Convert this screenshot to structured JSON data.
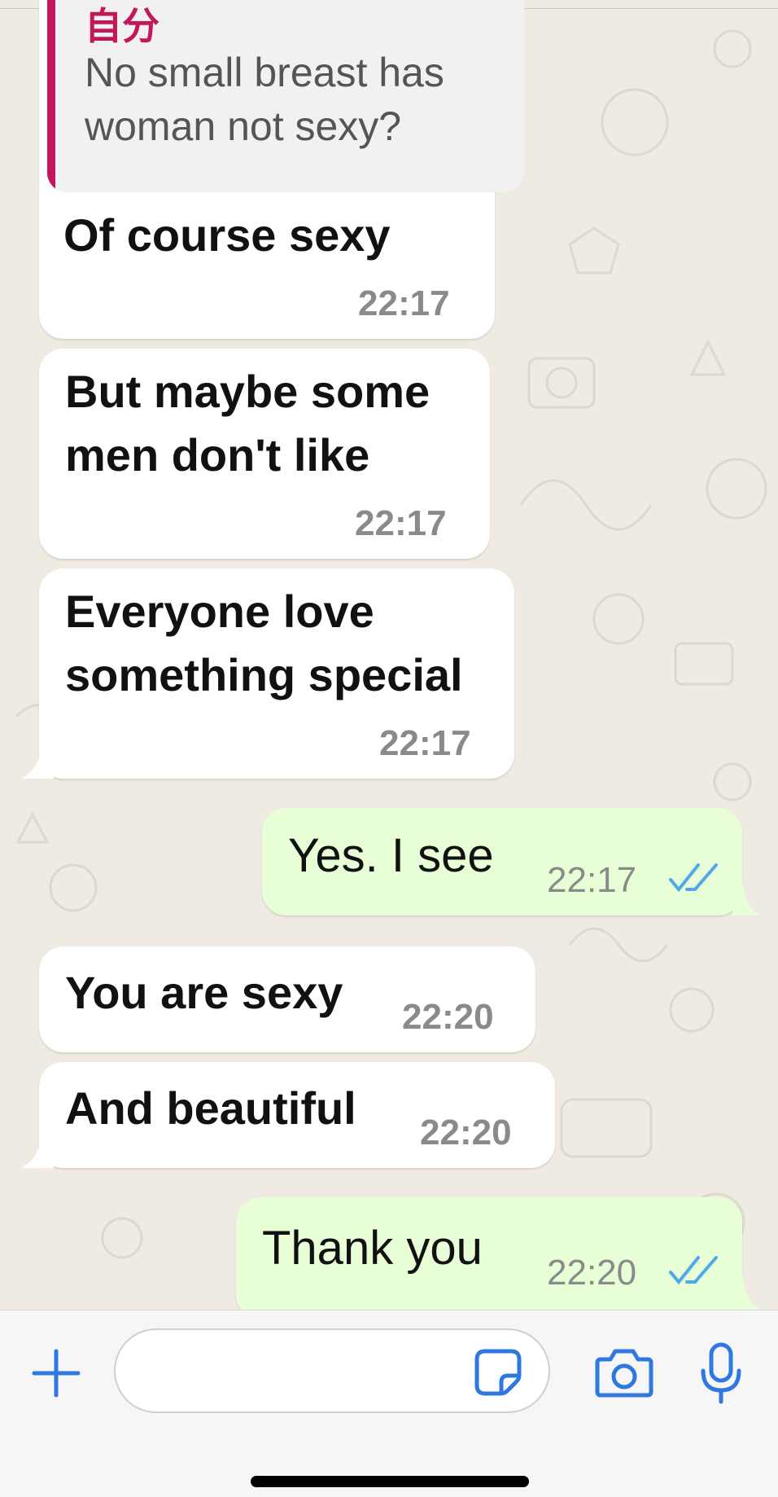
{
  "quote": {
    "author": "自分",
    "text": "No small breast has woman not sexy?"
  },
  "messages": [
    {
      "direction": "in",
      "text_lines": [
        "Of course sexy"
      ],
      "time": "22:17"
    },
    {
      "direction": "in",
      "text_lines": [
        "But maybe some",
        "men don't like"
      ],
      "time": "22:17"
    },
    {
      "direction": "in",
      "text_lines": [
        "Everyone love",
        "something special"
      ],
      "time": "22:17"
    },
    {
      "direction": "out",
      "text_lines": [
        "Yes. I see"
      ],
      "time": "22:17",
      "status": "read"
    },
    {
      "direction": "in",
      "text_lines": [
        "You are sexy"
      ],
      "time": "22:20"
    },
    {
      "direction": "in",
      "text_lines": [
        "And beautiful"
      ],
      "time": "22:20"
    },
    {
      "direction": "out",
      "text_lines": [
        "Thank you"
      ],
      "time": "22:20",
      "status": "read"
    }
  ],
  "composer": {
    "placeholder": "",
    "icons": [
      "plus-icon",
      "sticker-icon",
      "camera-icon",
      "microphone-icon"
    ]
  },
  "colors": {
    "accent": "#2f78e0",
    "quote_bar": "#c2185b",
    "outgoing_bubble": "#e7fed7",
    "incoming_bubble": "#ffffff",
    "read_ticks": "#4fa8e8"
  }
}
